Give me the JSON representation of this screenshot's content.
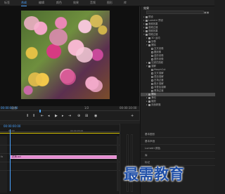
{
  "tabs": [
    "标签",
    "合成",
    "编辑",
    "颜色",
    "效果",
    "音频",
    "图形",
    "库"
  ],
  "active_tab_index": 1,
  "monitor": {
    "timecode_left": "00:00:00:00",
    "fit_label": "适合",
    "fraction": "1/2",
    "timecode_right": "00:00:10:00"
  },
  "effects_panel": {
    "title": "效果",
    "tree": [
      {
        "label": "预设",
        "indent": 1,
        "twirl": "▸",
        "kind": "folder"
      },
      {
        "label": "Lumetri 预设",
        "indent": 1,
        "twirl": "▸",
        "kind": "folder"
      },
      {
        "label": "音频效果",
        "indent": 1,
        "twirl": "▸",
        "kind": "folder"
      },
      {
        "label": "音频过渡",
        "indent": 1,
        "twirl": "▸",
        "kind": "folder"
      },
      {
        "label": "视频效果",
        "indent": 1,
        "twirl": "▸",
        "kind": "folder"
      },
      {
        "label": "视频过渡",
        "indent": 1,
        "twirl": "▾",
        "kind": "folder"
      },
      {
        "label": "3D 运动",
        "indent": 2,
        "twirl": "▸",
        "kind": "folder"
      },
      {
        "label": "划像",
        "indent": 2,
        "twirl": "▸",
        "kind": "folder"
      },
      {
        "label": "擦除",
        "indent": 2,
        "twirl": "▾",
        "kind": "folder"
      },
      {
        "label": "交叉划像",
        "indent": 3,
        "twirl": "",
        "kind": "fx"
      },
      {
        "label": "圆划像",
        "indent": 3,
        "twirl": "",
        "kind": "fx"
      },
      {
        "label": "盒形划像",
        "indent": 3,
        "twirl": "",
        "kind": "fx"
      },
      {
        "label": "菱形划像",
        "indent": 3,
        "twirl": "",
        "kind": "fx"
      },
      {
        "label": "沉浸式视频",
        "indent": 2,
        "twirl": "▸",
        "kind": "folder"
      },
      {
        "label": "溶解",
        "indent": 2,
        "twirl": "▾",
        "kind": "folder"
      },
      {
        "label": "MorphCut",
        "indent": 3,
        "twirl": "",
        "kind": "fx"
      },
      {
        "label": "交叉溶解",
        "indent": 3,
        "twirl": "",
        "kind": "fx"
      },
      {
        "label": "叠加溶解",
        "indent": 3,
        "twirl": "",
        "kind": "fx"
      },
      {
        "label": "白场过渡",
        "indent": 3,
        "twirl": "",
        "kind": "fx"
      },
      {
        "label": "胶片溶解",
        "indent": 3,
        "twirl": "",
        "kind": "fx"
      },
      {
        "label": "非叠加溶解",
        "indent": 3,
        "twirl": "",
        "kind": "fx"
      },
      {
        "label": "黑场过渡",
        "indent": 3,
        "twirl": "",
        "kind": "fx"
      },
      {
        "label": "擦除",
        "indent": 2,
        "twirl": "▸",
        "kind": "folder",
        "selected": true
      },
      {
        "label": "滑动",
        "indent": 2,
        "twirl": "▸",
        "kind": "folder"
      },
      {
        "label": "缩放",
        "indent": 2,
        "twirl": "▸",
        "kind": "folder"
      },
      {
        "label": "页面剥落",
        "indent": 2,
        "twirl": "▸",
        "kind": "folder"
      }
    ],
    "lower_sections": [
      "基本图形",
      "基本声音",
      "Lumetri 颜色",
      "库",
      "标记"
    ]
  },
  "timeline": {
    "timecode": "00:00:00:00",
    "ruler_ticks": [
      "00:00",
      "00:00:05:00"
    ],
    "clip_prefix": "fx",
    "clip_label": "花海.avi"
  },
  "watermark": "最需教育"
}
